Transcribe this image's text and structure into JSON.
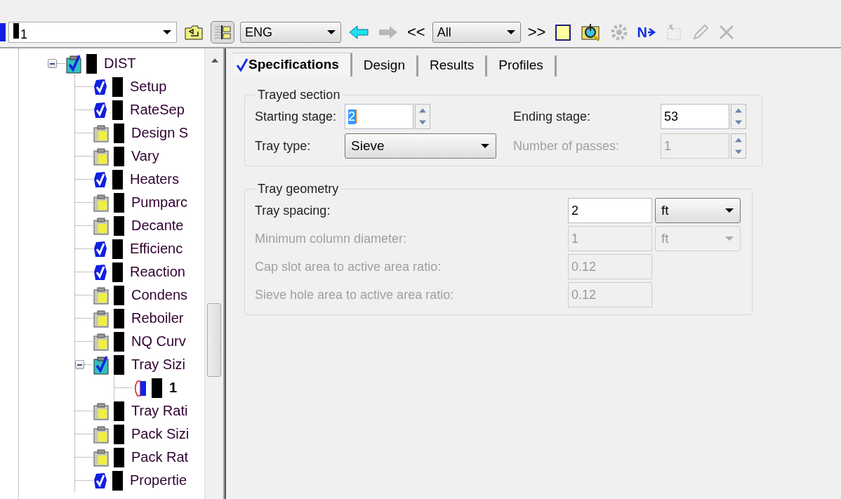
{
  "toolbar": {
    "items": [
      {
        "kind": "object-combo",
        "value": "1"
      },
      {
        "kind": "folder-up",
        "disabled": false
      },
      {
        "kind": "tree-toggle",
        "selected": true
      },
      {
        "kind": "units-combo",
        "value": "ENG"
      },
      {
        "kind": "back",
        "disabled": false
      },
      {
        "kind": "forward",
        "disabled": true
      },
      {
        "kind": "text-button",
        "label": "<<"
      },
      {
        "kind": "filter-combo",
        "value": "All"
      },
      {
        "kind": "text-button",
        "label": ">>"
      },
      {
        "kind": "notepad",
        "disabled": false
      },
      {
        "kind": "clipboard-search",
        "disabled": false
      },
      {
        "kind": "gear",
        "disabled": true
      },
      {
        "kind": "next",
        "label": "N",
        "disabled": false
      },
      {
        "kind": "stamp",
        "disabled": true
      },
      {
        "kind": "pencil",
        "disabled": true
      },
      {
        "kind": "close",
        "disabled": true
      }
    ]
  },
  "tree": {
    "items": [
      {
        "label": "DIST",
        "kind": "checked-folder",
        "expanded": true,
        "children": [
          {
            "label": "Setup",
            "kind": "done"
          },
          {
            "label": "RateSep",
            "kind": "done"
          },
          {
            "label": "Design S",
            "kind": "input"
          },
          {
            "label": "Vary",
            "kind": "input"
          },
          {
            "label": "Heaters",
            "kind": "done"
          },
          {
            "label": "Pumparc",
            "kind": "input"
          },
          {
            "label": "Decante",
            "kind": "input"
          },
          {
            "label": "Efficienc",
            "kind": "done"
          },
          {
            "label": "Reaction",
            "kind": "done"
          },
          {
            "label": "Condens",
            "kind": "input"
          },
          {
            "label": "Reboiler",
            "kind": "input"
          },
          {
            "label": "NQ Curv",
            "kind": "input"
          },
          {
            "label": "Tray Sizi",
            "kind": "checked-folder",
            "expanded": true,
            "children": [
              {
                "label": "1",
                "kind": "partial"
              }
            ]
          },
          {
            "label": "Tray Rati",
            "kind": "input"
          },
          {
            "label": "Pack Sizi",
            "kind": "input"
          },
          {
            "label": "Pack Rat",
            "kind": "input"
          },
          {
            "label": "Propertie",
            "kind": "done"
          }
        ]
      }
    ]
  },
  "tabs": [
    {
      "label": "Specifications",
      "selected": true,
      "complete": true
    },
    {
      "label": "Design",
      "selected": false,
      "complete": false
    },
    {
      "label": "Results",
      "selected": false,
      "complete": false
    },
    {
      "label": "Profiles",
      "selected": false,
      "complete": false
    }
  ],
  "trayed_section": {
    "title": "Trayed section",
    "fields": [
      {
        "label": "Starting stage:",
        "kind": "spin",
        "value": "2",
        "text_selected": true,
        "disabled": false
      },
      {
        "label": "Ending stage:",
        "kind": "spin",
        "value": "53",
        "disabled": false
      },
      {
        "label": "Tray type:",
        "kind": "select",
        "value": "Sieve",
        "disabled": false
      },
      {
        "label": "Number of passes:",
        "kind": "spin",
        "value": "1",
        "disabled": true
      }
    ]
  },
  "tray_geometry": {
    "title": "Tray geometry",
    "fields": [
      {
        "label": "Tray spacing:",
        "value": "2",
        "unit": "ft",
        "disabled": false
      },
      {
        "label": "Minimum column diameter:",
        "value": "1",
        "unit": "ft",
        "disabled": true
      },
      {
        "label": "Cap slot area to active area ratio:",
        "value": "0.12",
        "disabled": true
      },
      {
        "label": "Sieve hole area to active area ratio:",
        "value": "0.12",
        "disabled": true
      }
    ]
  }
}
